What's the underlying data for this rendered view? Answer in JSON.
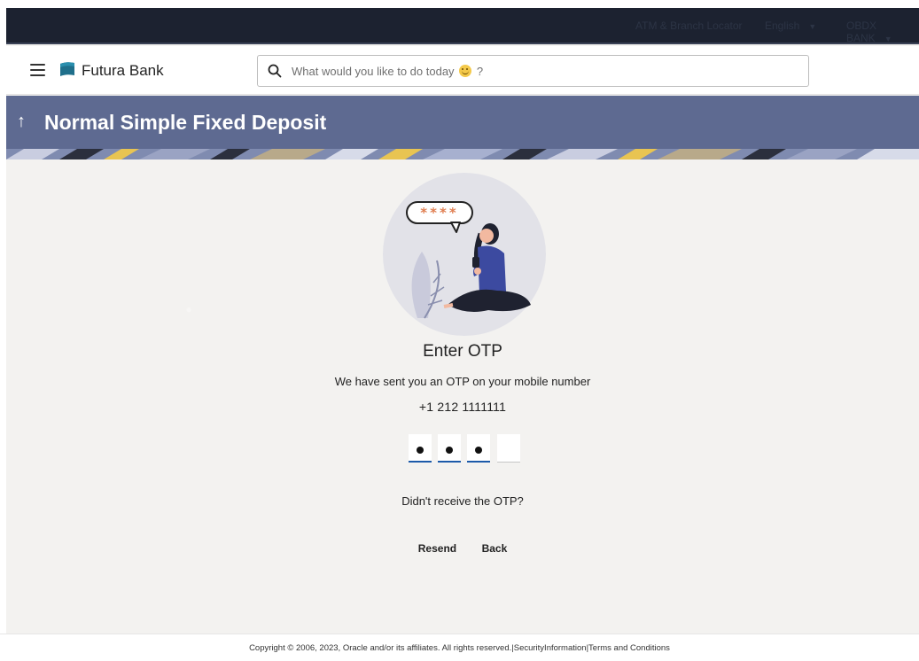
{
  "topbar": {
    "atm_locator": "ATM & Branch Locator",
    "language": "English",
    "user": "OBDX BANK"
  },
  "header": {
    "brand": "Futura Bank",
    "search_placeholder_pre": "What would you like to do today",
    "search_placeholder_post": "?"
  },
  "page": {
    "title": "Normal Simple Fixed Deposit"
  },
  "otp": {
    "heading": "Enter OTP",
    "message": "We have sent you an OTP on your mobile number",
    "phone": "+1 212 1111111",
    "digits_filled": 3,
    "digits_total": 4,
    "bubble_text": "****",
    "no_receive": "Didn't receive the OTP?",
    "resend_label": "Resend",
    "back_label": "Back"
  },
  "footer": {
    "copyright": "Copyright © 2006, 2023, Oracle and/or its affiliates. All rights reserved.",
    "separator": "|",
    "security": "SecurityInformation",
    "terms": "Terms and Conditions"
  },
  "colors": {
    "topbar": "#1c2230",
    "banner": "#5e6a91",
    "otp_underline": "#1c5aa9",
    "bubble_stars": "#e07f52"
  }
}
